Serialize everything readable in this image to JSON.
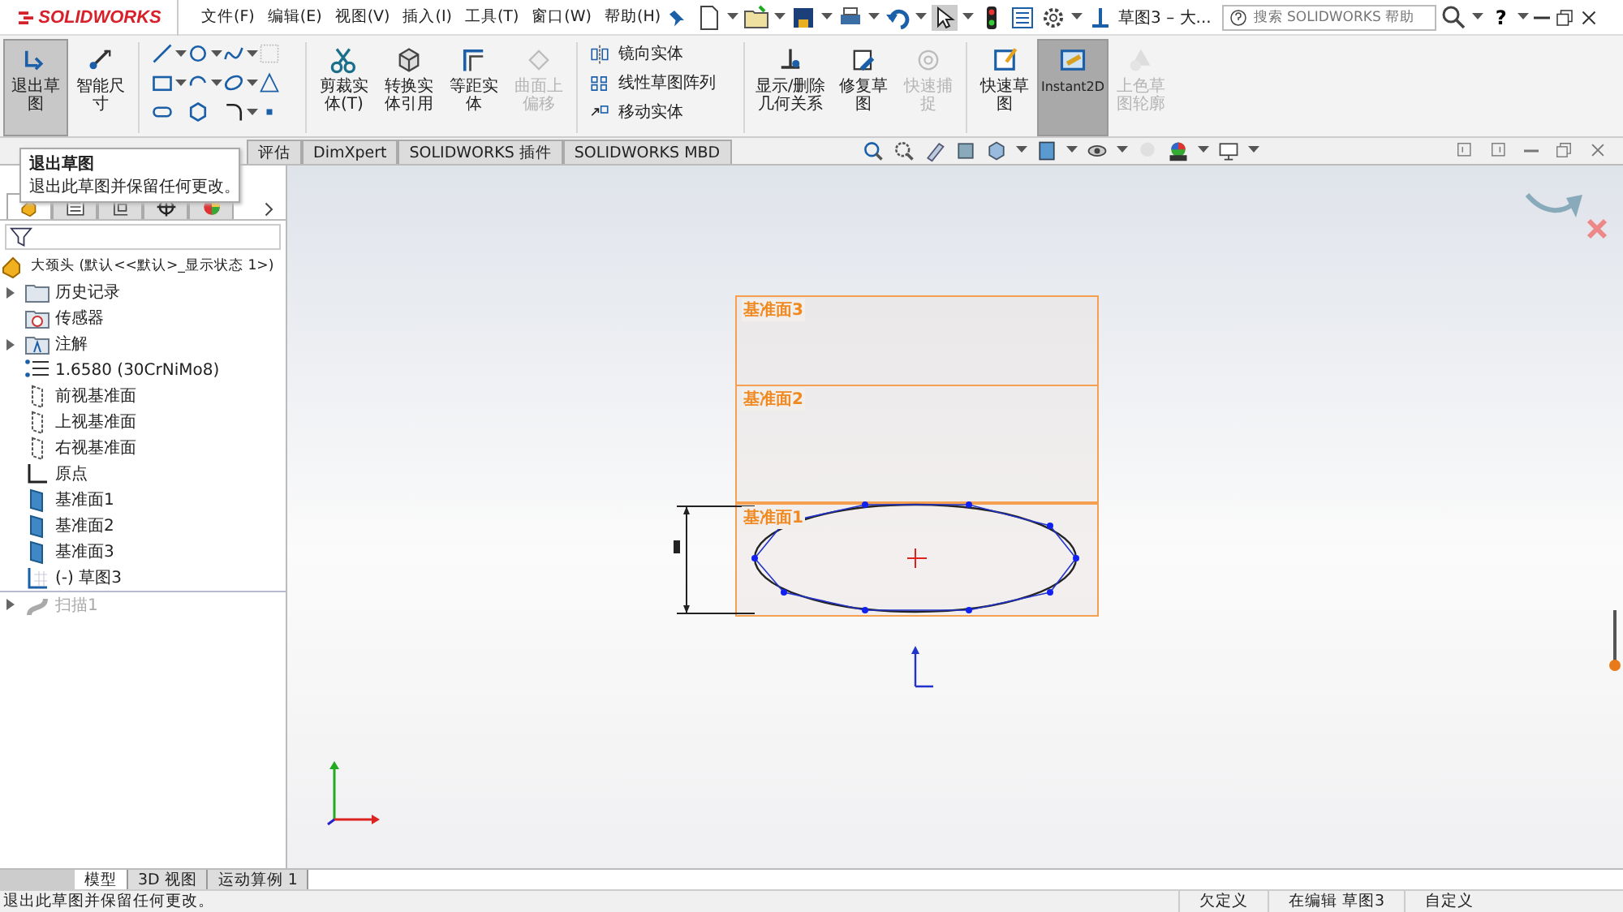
{
  "title_bar": {
    "logo": "SOLIDWORKS",
    "menu": [
      "文件(F)",
      "编辑(E)",
      "视图(V)",
      "插入(I)",
      "工具(T)",
      "窗口(W)",
      "帮助(H)"
    ],
    "doc_title": "草图3 – 大...",
    "search": {
      "placeholder": "搜索 SOLIDWORKS 帮助"
    },
    "help": "?"
  },
  "ribbon": [
    {
      "kind": "big",
      "label": "退出草图",
      "selected": true,
      "disabled": false
    },
    {
      "kind": "big",
      "label": "智能尺寸",
      "selected": false,
      "disabled": false
    },
    {
      "kind": "tools"
    },
    {
      "kind": "big",
      "label": "剪裁实体(T)",
      "selected": false,
      "disabled": false
    },
    {
      "kind": "big",
      "label": "转换实体引用",
      "selected": false,
      "disabled": false
    },
    {
      "kind": "big",
      "label": "等距实体",
      "selected": false,
      "disabled": false
    },
    {
      "kind": "big",
      "label": "曲面上偏移",
      "selected": false,
      "disabled": true
    },
    {
      "kind": "list",
      "items": [
        "镜向实体",
        "线性草图阵列",
        "移动实体"
      ]
    },
    {
      "kind": "big",
      "label": "显示/删除几何关系",
      "selected": false,
      "disabled": false
    },
    {
      "kind": "big",
      "label": "修复草图",
      "selected": false,
      "disabled": false
    },
    {
      "kind": "big",
      "label": "快速捕捉",
      "selected": false,
      "disabled": true
    },
    {
      "kind": "big",
      "label": "快速草图",
      "selected": false,
      "disabled": false
    },
    {
      "kind": "big",
      "label": "Instant2D",
      "selected": true,
      "disabled": false
    },
    {
      "kind": "big",
      "label": "上色草图轮廓",
      "selected": false,
      "disabled": true
    }
  ],
  "tabs": [
    {
      "label": "评估",
      "selected": false
    },
    {
      "label": "DimXpert",
      "selected": false
    },
    {
      "label": "SOLIDWORKS 插件",
      "selected": false
    },
    {
      "label": "SOLIDWORKS MBD",
      "selected": false
    }
  ],
  "tooltip": {
    "title": "退出草图",
    "text": "退出此草图并保留任何更改。"
  },
  "tree": {
    "root": "大颈头 (默认<<默认>_显示状态 1>)",
    "items": [
      {
        "label": "历史记录",
        "expandable": true,
        "disabled": false
      },
      {
        "label": "传感器",
        "expandable": false,
        "disabled": false
      },
      {
        "label": "注解",
        "expandable": true,
        "disabled": false
      },
      {
        "label": "1.6580 (30CrNiMo8)",
        "expandable": false,
        "disabled": false
      },
      {
        "label": "前视基准面",
        "expandable": false,
        "disabled": false
      },
      {
        "label": "上视基准面",
        "expandable": false,
        "disabled": false
      },
      {
        "label": "右视基准面",
        "expandable": false,
        "disabled": false
      },
      {
        "label": "原点",
        "expandable": false,
        "disabled": false
      },
      {
        "label": "基准面1",
        "expandable": false,
        "disabled": false
      },
      {
        "label": "基准面2",
        "expandable": false,
        "disabled": false
      },
      {
        "label": "基准面3",
        "expandable": false,
        "disabled": false
      },
      {
        "label": "(-) 草图3",
        "expandable": false,
        "disabled": false
      },
      {
        "label": "扫描1",
        "expandable": true,
        "disabled": true
      }
    ]
  },
  "canvas": {
    "planes": [
      "基准面3",
      "基准面2",
      "基准面1"
    ]
  },
  "bottom_tabs": [
    {
      "label": "模型",
      "selected": true
    },
    {
      "label": "3D 视图",
      "selected": false
    },
    {
      "label": "运动算例 1",
      "selected": false
    }
  ],
  "status_bar": {
    "message": "退出此草图并保留任何更改。",
    "fields": [
      "欠定义",
      "在编辑 草图3",
      "自定义"
    ]
  }
}
